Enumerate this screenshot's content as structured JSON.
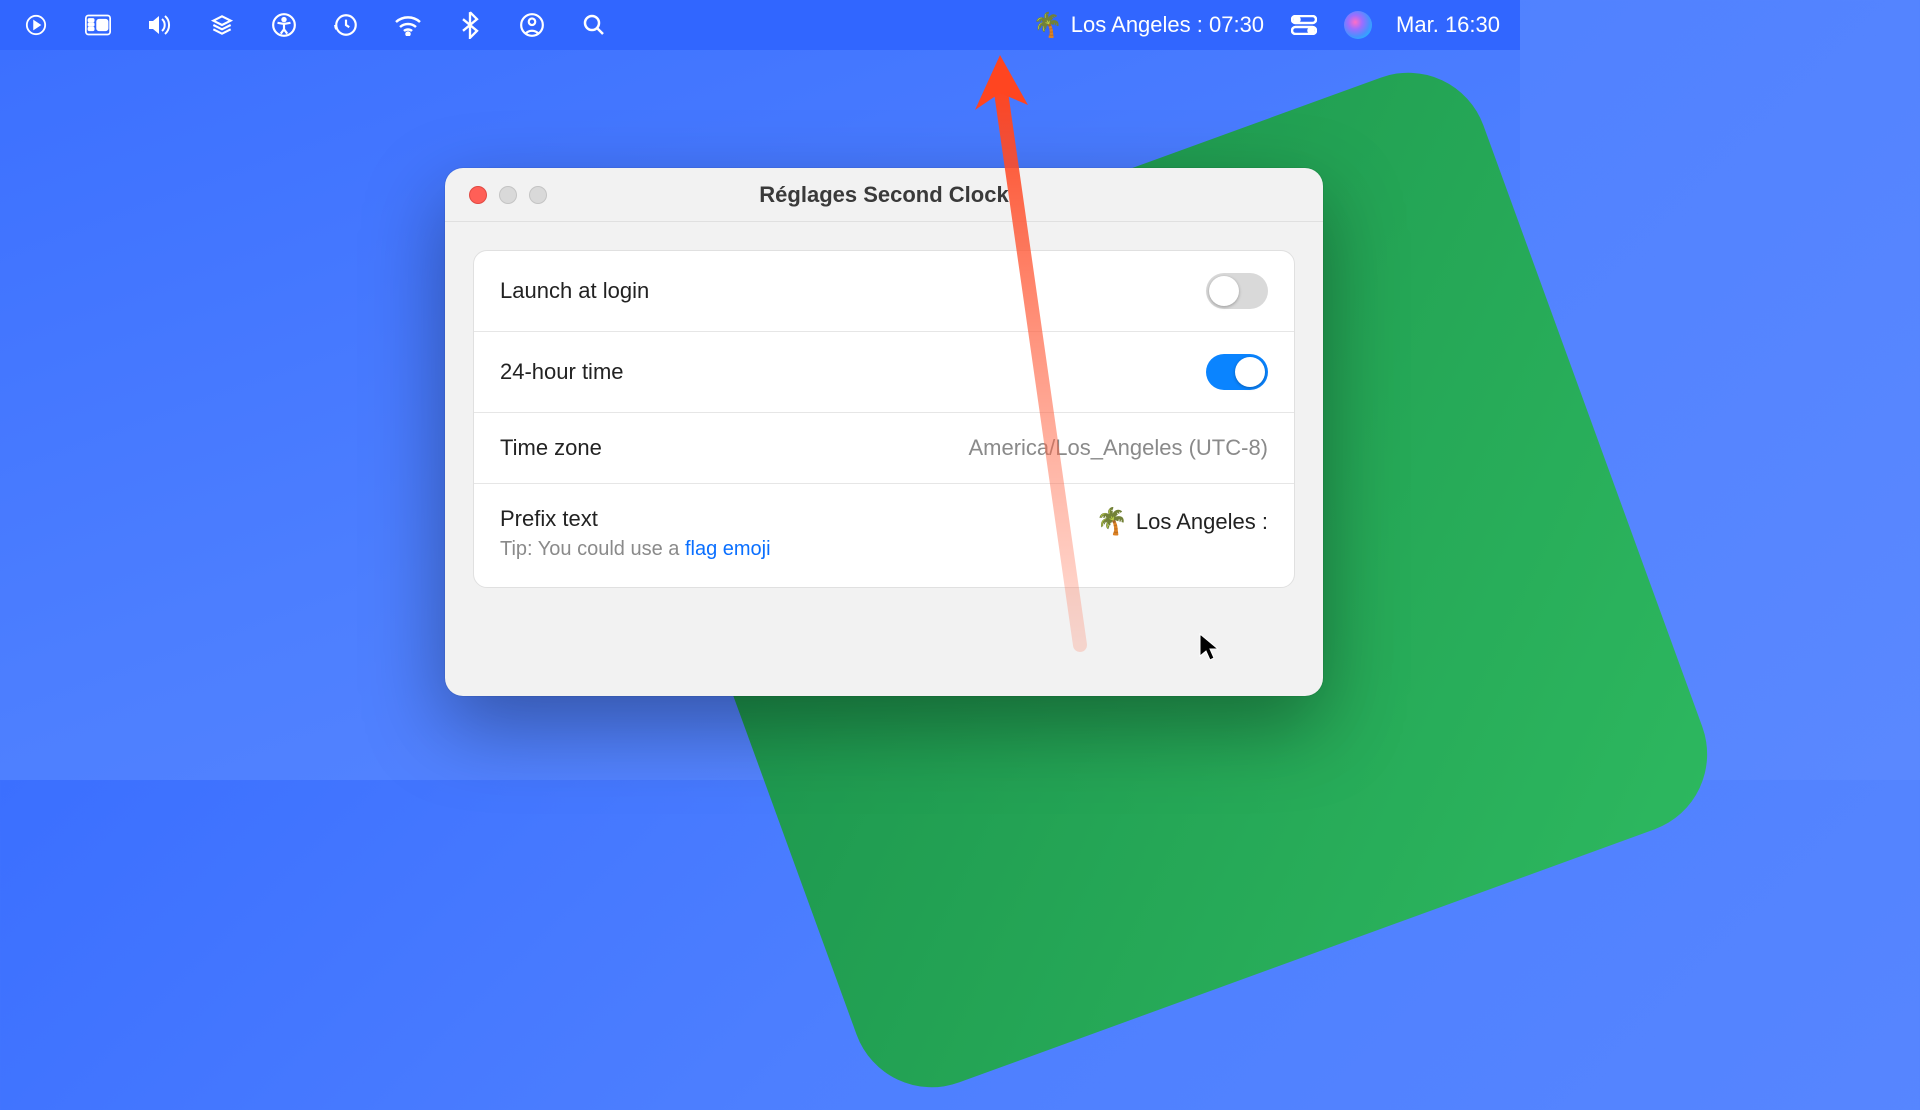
{
  "menubar": {
    "second_clock": {
      "emoji": "🌴",
      "text": "Los Angeles : 07:30"
    },
    "system_clock": "Mar. 16:30"
  },
  "window": {
    "title": "Réglages Second Clock",
    "settings": {
      "launch_at_login": {
        "label": "Launch at login",
        "enabled": false
      },
      "twentyfour_hour": {
        "label": "24-hour time",
        "enabled": true
      },
      "timezone": {
        "label": "Time zone",
        "value": "America/Los_Angeles (UTC-8)"
      },
      "prefix": {
        "label": "Prefix text",
        "value_emoji": "🌴",
        "value_text": "Los Angeles :",
        "tip_prefix": "Tip: You could use a ",
        "tip_link": "flag emoji"
      }
    }
  }
}
